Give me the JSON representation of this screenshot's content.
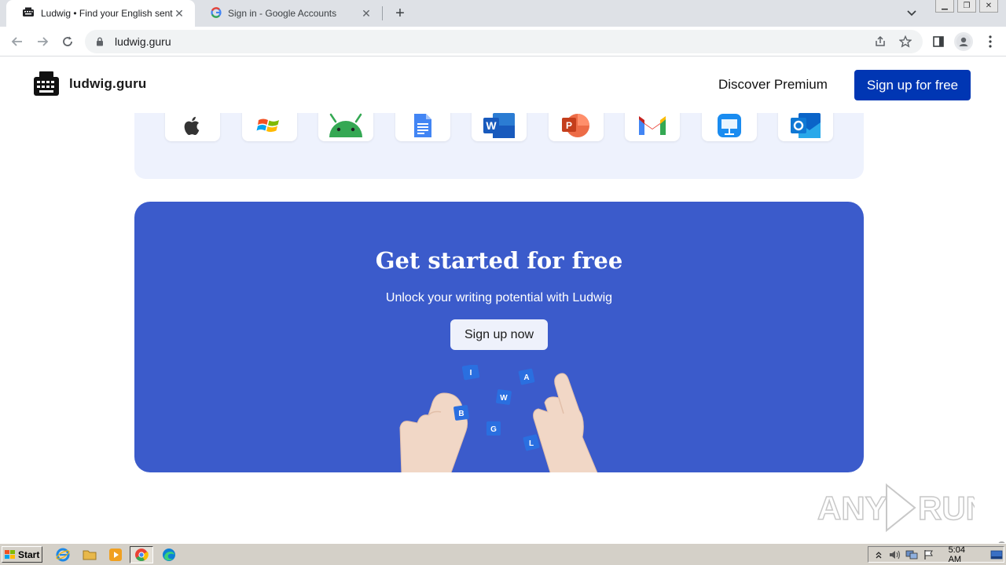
{
  "browser": {
    "tabs": [
      {
        "title": "Ludwig • Find your English sentence",
        "active": true
      },
      {
        "title": "Sign in - Google Accounts",
        "active": false
      }
    ],
    "new_tab_label": "+",
    "url": "ludwig.guru"
  },
  "site": {
    "logo_text": "ludwig.guru",
    "premium_label": "Discover Premium",
    "signup_label": "Sign up for free",
    "integrations": [
      "apple-icon",
      "windows-icon",
      "android-icon",
      "google-docs-icon",
      "word-icon",
      "powerpoint-icon",
      "gmail-icon",
      "keynote-icon",
      "outlook-icon"
    ],
    "cta": {
      "title": "Get started for free",
      "subtitle": "Unlock your writing potential with Ludwig",
      "button": "Sign up now",
      "letters": [
        "I",
        "A",
        "W",
        "B",
        "G",
        "L"
      ]
    }
  },
  "watermark": {
    "text_left": "ANY",
    "text_right": "RUN"
  },
  "taskbar": {
    "start_label": "Start",
    "clock": "5:04 AM"
  },
  "colors": {
    "brand_blue": "#0036b3",
    "cta_blue": "#3b5bcb",
    "integrations_bg": "#eef2fd"
  }
}
